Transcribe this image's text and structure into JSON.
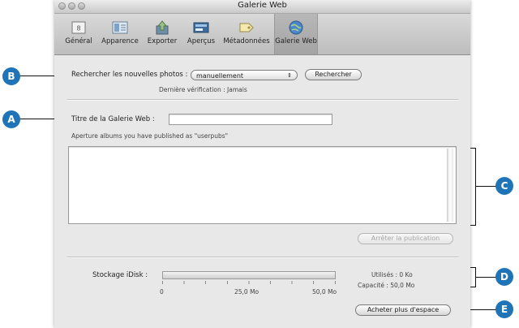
{
  "window": {
    "title": "Galerie Web"
  },
  "toolbar": {
    "tabs": [
      {
        "label": "Général",
        "icon": "general-icon"
      },
      {
        "label": "Apparence",
        "icon": "appearance-icon"
      },
      {
        "label": "Exporter",
        "icon": "export-icon"
      },
      {
        "label": "Aperçus",
        "icon": "previews-icon"
      },
      {
        "label": "Métadonnées",
        "icon": "metadata-icon"
      },
      {
        "label": "Galerie Web",
        "icon": "web-gallery-icon",
        "selected": true
      }
    ]
  },
  "check": {
    "label": "Rechercher les nouvelles photos :",
    "popup_value": "manuellement",
    "button": "Rechercher",
    "last_check": "Dernière vérification : Jamais"
  },
  "gallery": {
    "title_label": "Titre de la Galerie Web :",
    "title_value": "",
    "albums_note": "Aperture albums you have published as \"userpubs\"",
    "stop_button": "Arrêter la publication"
  },
  "storage": {
    "label": "Stockage iDisk :",
    "used_fraction": 0,
    "ticks": [
      "0",
      "25,0 Mo",
      "50,0 Mo"
    ],
    "used": "Utilisés : 0 Ko",
    "capacity": "Capacité : 50,0 Mo",
    "buy_button": "Acheter plus d'espace"
  },
  "callouts": [
    "A",
    "B",
    "C",
    "D",
    "E"
  ],
  "colors": {
    "callout": "#1f73b7",
    "window_bg": "#e8e8e8"
  }
}
